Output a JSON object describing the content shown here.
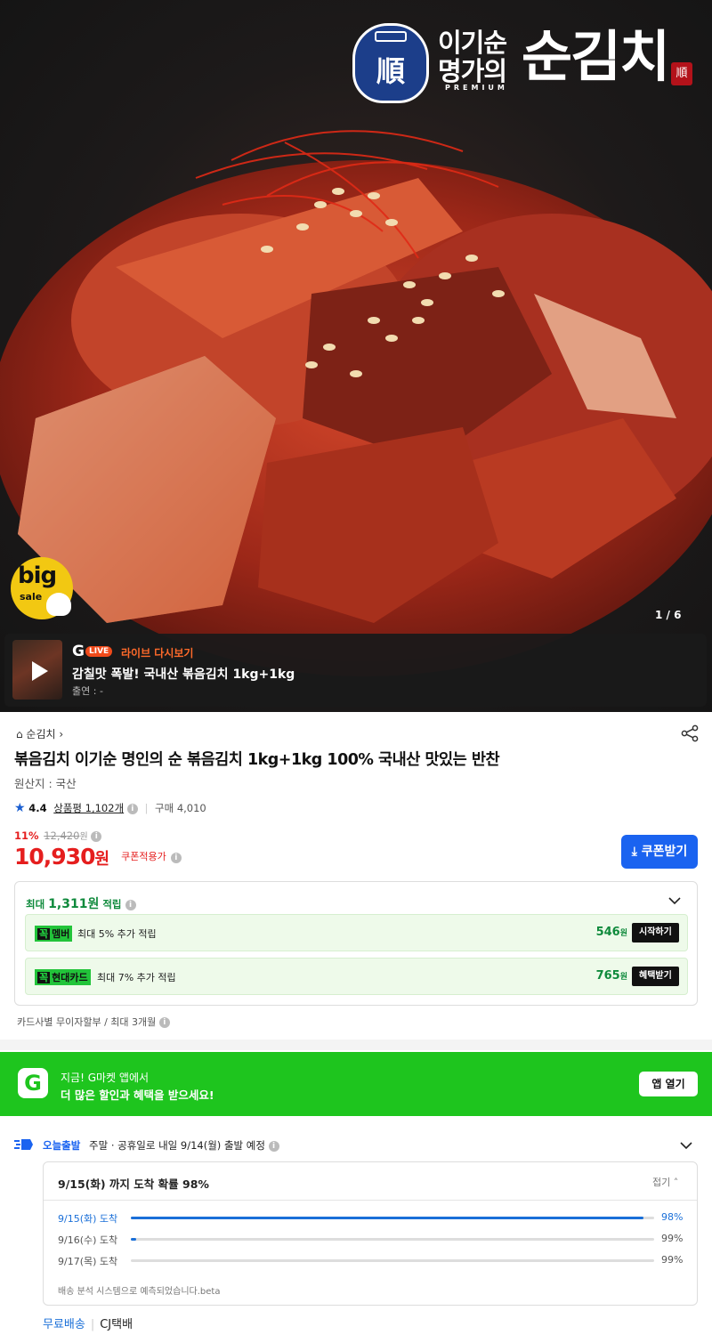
{
  "hero": {
    "brand": {
      "jar_char": "順",
      "name_line1": "이기순",
      "name_line2": "명가의",
      "premium": "PREMIUM",
      "big_name": "순김치",
      "seal": "順"
    },
    "badge": {
      "big": "big",
      "sale": "sale"
    },
    "pager": "1 / 6"
  },
  "live": {
    "g": "G",
    "live_pill": "LIVE",
    "tag": "라이브 다시보기",
    "title": "감칠맛 폭발! 국내산 볶음김치 1kg+1kg",
    "cast": "출연 : -"
  },
  "product": {
    "breadcrumb": "⌂ 순김치 ›",
    "title": "볶음김치 이기순 명인의 순 볶음김치 1kg+1kg 100% 국내산 맛있는 반찬",
    "origin": "원산지 : 국산",
    "rating": "4.4",
    "review_label": "상품평 1,102개",
    "purchases": "구매 4,010",
    "discount_rate": "11%",
    "original_price": "12,420",
    "won_small": "원",
    "price": "10,930",
    "won": "원",
    "coupon_applied": "쿠폰적용가",
    "coupon_button": "쿠폰받기"
  },
  "reward": {
    "head_prefix": "최대 ",
    "head_amount": "1,311원",
    "head_suffix": " 적립",
    "items": [
      {
        "kkok": "꼭",
        "tag": "멤버",
        "text": "최대 5% 추가 적립",
        "points": "546",
        "unit": "원",
        "button": "시작하기"
      },
      {
        "kkok": "꼭",
        "tag": "현대카드",
        "text": "최대 7% 추가 적립",
        "points": "765",
        "unit": "원",
        "button": "혜택받기"
      }
    ]
  },
  "installment": "카드사별 무이자할부 / 최대 3개월",
  "app_banner": {
    "logo": "G",
    "line1": "지금! G마켓 앱에서",
    "line2": "더 많은 할인과 혜택을 받으세요!",
    "button": "앱 열기"
  },
  "delivery": {
    "tag": "오늘출발",
    "note": "주말 · 공휴일로 내일 9/14(월) 출발 예정",
    "header": "9/15(화) 까지 도착 확률 98%",
    "fold": "접기 ˄",
    "rows": [
      {
        "date": "9/15(화) 도착",
        "pct": "98%",
        "value": 98,
        "highlight": true
      },
      {
        "date": "9/16(수) 도착",
        "pct": "99%",
        "value": 1,
        "highlight": false
      },
      {
        "date": "9/17(목) 도착",
        "pct": "99%",
        "value": 0,
        "highlight": false
      }
    ],
    "note2": "배송 분석 시스템으로 예측되었습니다.beta",
    "free_shipping": "무료배송",
    "carrier": "CJ택배"
  },
  "colors": {
    "accent_blue": "#1a63f0",
    "price_red": "#e51e1e",
    "reward_green": "#0f8a3c",
    "banner_green": "#1ec51e"
  }
}
